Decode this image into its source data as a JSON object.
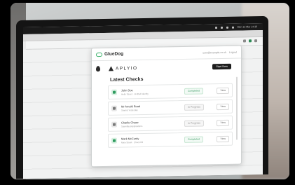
{
  "menubar": {
    "clock": "Mon 13 Mar 14:30"
  },
  "popup": {
    "brand": "GlueDog",
    "account_email": "user@example.co.uk",
    "logout_label": "Logout",
    "org_name": "APLYIO",
    "start_button": "Start New",
    "section_title": "Latest Checks"
  },
  "checks": [
    {
      "name": "John Doe",
      "sub": "Hello Street · Verified Identity",
      "status": "Completed",
      "action": "View",
      "kind": "completed"
    },
    {
      "name": "Mr Arnold Road",
      "sub": "Started Yesterday",
      "status": "In Progress",
      "action": "View",
      "kind": "progress"
    },
    {
      "name": "Charlie Chase",
      "sub": "Submitted Applications",
      "status": "In Progress",
      "action": "View",
      "kind": "progress"
    },
    {
      "name": "Mark McCurdy",
      "sub": "Main Street · Check Rd",
      "status": "Completed",
      "action": "View",
      "kind": "completed"
    }
  ]
}
